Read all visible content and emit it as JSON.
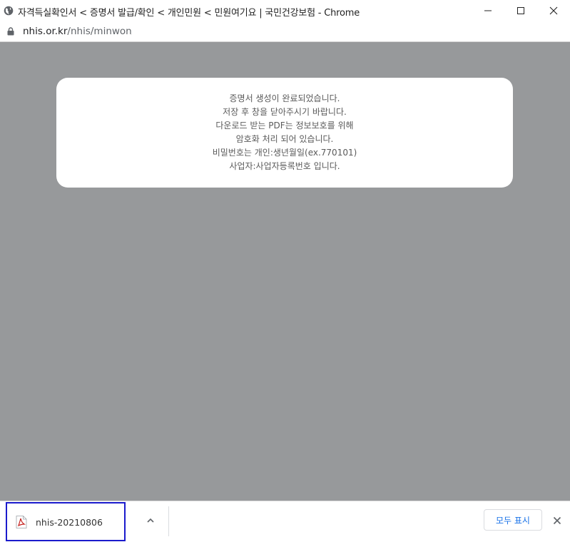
{
  "window": {
    "title": "자격득실확인서 < 증명서 발급/확인 < 개인민원 < 민원여기요 | 국민건강보험 - Chrome"
  },
  "address": {
    "host": "nhis.or.kr",
    "path": "/nhis/minwon/"
  },
  "message": {
    "lines": [
      "증명서 생성이 완료되었습니다.",
      "저장 후 창을 닫아주시기 바랍니다.",
      "다운로드 받는 PDF는 정보보호를 위해",
      "암호화 처리 되어 있습니다.",
      "비밀번호는 개인:생년월일(ex.770101)",
      "사업자:사업자등록번호 입니다."
    ]
  },
  "downloads": {
    "file_name": "nhis-20210806",
    "show_all_label": "모두 표시"
  },
  "icons": {
    "site": "globe-icon",
    "lock": "lock-icon",
    "file": "pdf-icon",
    "expand": "chevron-up-icon",
    "close": "close-icon"
  },
  "colors": {
    "page_background": "#97999b",
    "highlight_border": "#1a1acc",
    "show_all_text": "#1a73e8"
  }
}
